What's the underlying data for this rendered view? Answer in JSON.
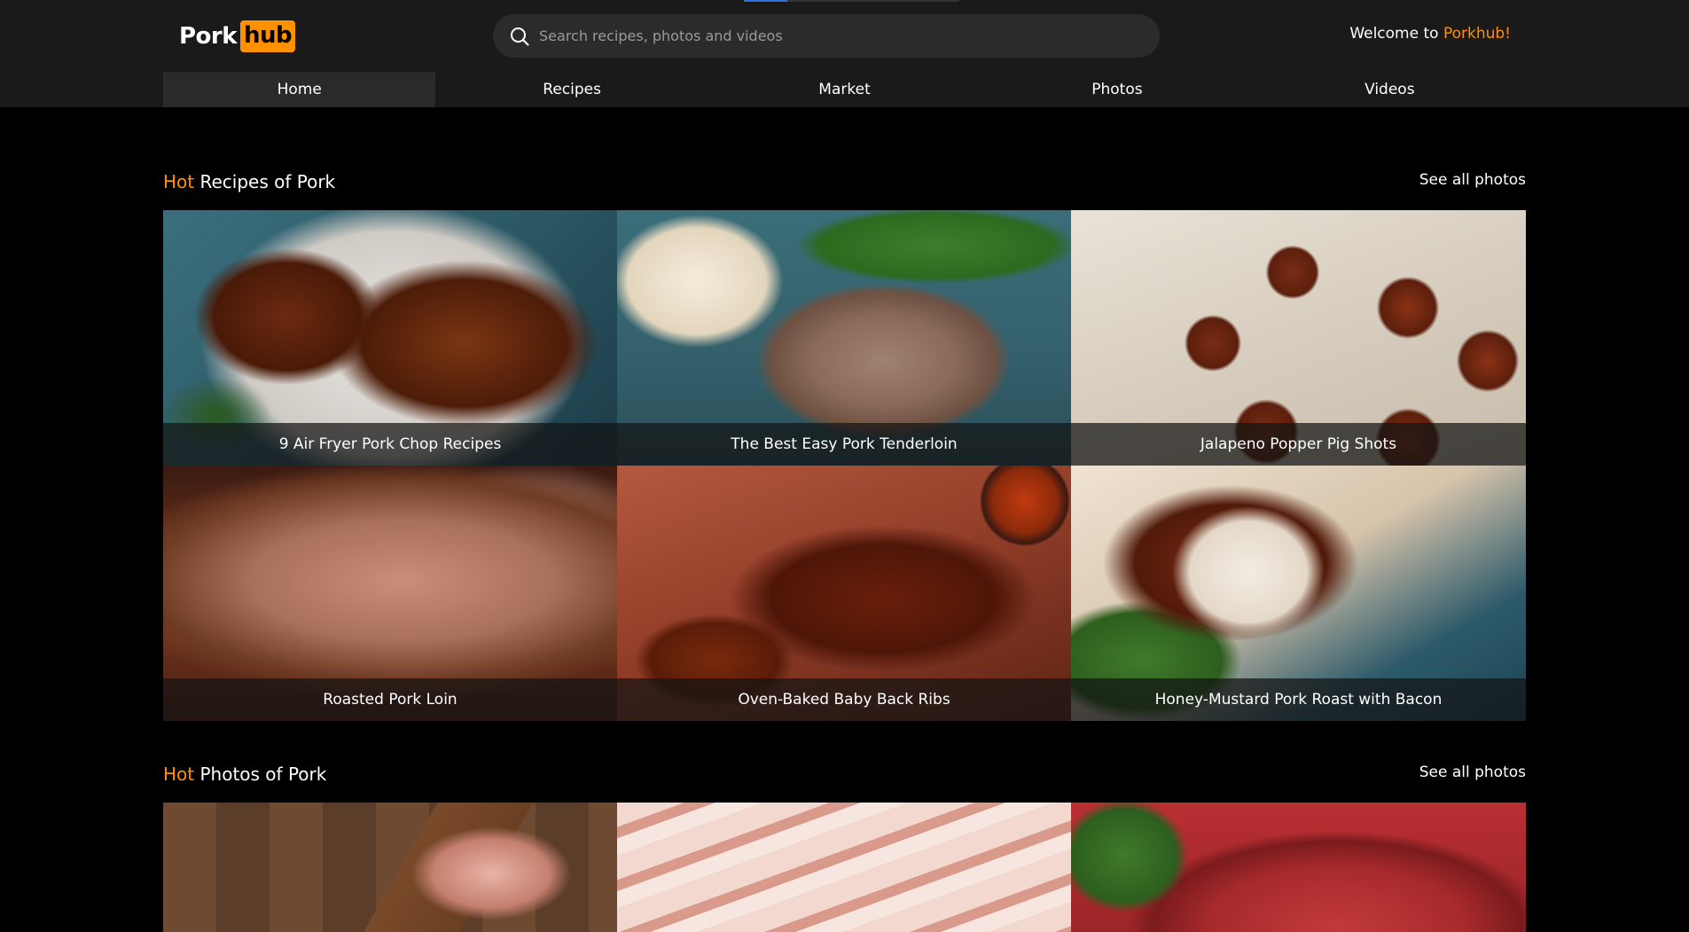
{
  "header": {
    "logo": {
      "part1": "Pork",
      "part2": "hub"
    },
    "search": {
      "placeholder": "Search recipes, photos and videos",
      "value": ""
    },
    "welcome": {
      "prefix": "Welcome to ",
      "brand": "Porkhub!"
    },
    "nav": [
      {
        "label": "Home",
        "active": true
      },
      {
        "label": "Recipes",
        "active": false
      },
      {
        "label": "Market",
        "active": false
      },
      {
        "label": "Photos",
        "active": false
      },
      {
        "label": "Videos",
        "active": false
      }
    ]
  },
  "recipes": {
    "title_hot": "Hot",
    "title_rest": " Recipes of Pork",
    "see_all": "See all photos",
    "items": [
      {
        "caption": "9 Air Fryer Pork Chop Recipes"
      },
      {
        "caption": "The Best Easy Pork Tenderloin"
      },
      {
        "caption": "Jalapeno Popper Pig Shots"
      },
      {
        "caption": "Roasted Pork Loin"
      },
      {
        "caption": "Oven-Baked Baby Back Ribs"
      },
      {
        "caption": "Honey-Mustard Pork Roast with Bacon"
      }
    ]
  },
  "photos": {
    "title_hot": "Hot",
    "title_rest": " Photos of Pork",
    "see_all": "See all photos"
  },
  "colors": {
    "accent": "#ff9000",
    "background": "#000000",
    "header_bg": "#1a1a1a",
    "search_bg": "#2b2b2b"
  },
  "icons": {
    "search": "search-icon"
  }
}
